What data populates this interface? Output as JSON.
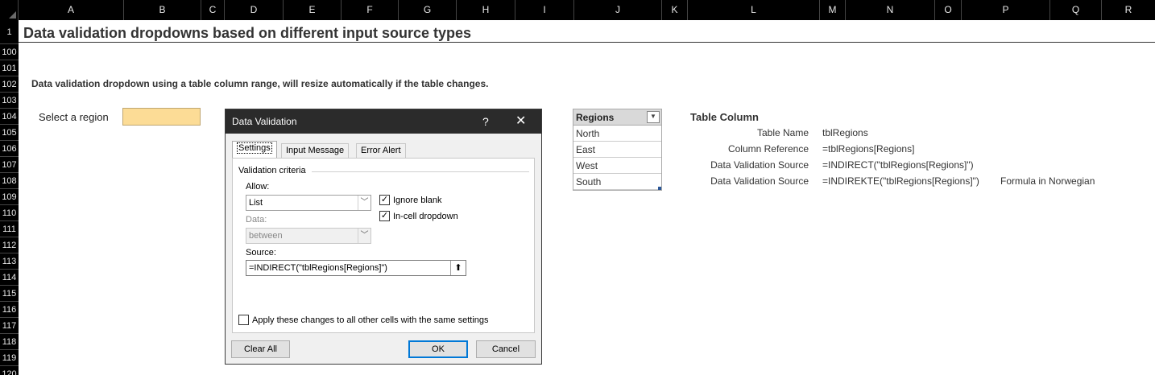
{
  "columns": [
    "A",
    "B",
    "C",
    "D",
    "E",
    "F",
    "G",
    "H",
    "I",
    "J",
    "K",
    "L",
    "M",
    "N",
    "O",
    "P",
    "Q",
    "R"
  ],
  "rows": [
    "1",
    "100",
    "101",
    "102",
    "103",
    "104",
    "105",
    "106",
    "107",
    "108",
    "109",
    "110",
    "111",
    "112",
    "113",
    "114",
    "115",
    "116",
    "117",
    "118",
    "119",
    "120"
  ],
  "sheet": {
    "title": "Data validation dropdowns based on different input source types",
    "description": "Data validation dropdown using a table column range, will resize automatically if the table changes.",
    "select_label": "Select a region",
    "select_value": "",
    "select_fill": "#fcdc96"
  },
  "table": {
    "header": "Regions",
    "filter_icon": "dropdown-arrow",
    "rows": [
      "North",
      "East",
      "West",
      "South"
    ]
  },
  "info": {
    "heading": "Table Column",
    "rows": [
      {
        "key": "Table Name",
        "value": "tblRegions",
        "note": ""
      },
      {
        "key": "Column Reference",
        "value": "=tblRegions[Regions]",
        "note": ""
      },
      {
        "key": "Data Validation Source",
        "value": "=INDIRECT(\"tblRegions[Regions]\")",
        "note": ""
      },
      {
        "key": "Data Validation Source",
        "value": "=INDIREKTE(\"tblRegions[Regions]\")",
        "note": "Formula in Norwegian"
      }
    ]
  },
  "dialog": {
    "title": "Data Validation",
    "help": "?",
    "close": "✕",
    "tabs": [
      "Settings",
      "Input Message",
      "Error Alert"
    ],
    "active_tab": "Settings",
    "section": "Validation criteria",
    "allow_label": "Allow:",
    "allow_value": "List",
    "data_label": "Data:",
    "data_value": "between",
    "ignore_blank": {
      "label": "Ignore blank",
      "checked": true
    },
    "in_cell_dropdown": {
      "label": "In-cell dropdown",
      "checked": true
    },
    "source_label": "Source:",
    "source_value": "=INDIRECT(\"tblRegions[Regions]\")",
    "apply_all": {
      "label": "Apply these changes to all other cells with the same settings",
      "checked": false
    },
    "clear_all": "Clear All",
    "ok": "OK",
    "cancel": "Cancel"
  }
}
